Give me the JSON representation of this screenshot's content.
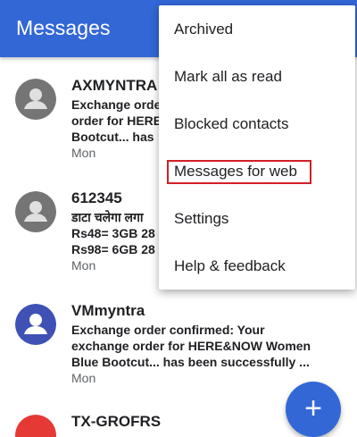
{
  "appbar": {
    "title": "Messages"
  },
  "conversations": [
    {
      "sender": "AXMYNTRA",
      "lines": [
        "Exchange order",
        "order for HERE",
        "Bootcut... has"
      ],
      "date": "Mon",
      "avatar_color": "#757575",
      "avatar_kind": "person-icon"
    },
    {
      "sender": "612345",
      "lines": [
        "डाटा चलेगा लगा",
        "Rs48= 3GB 28",
        "Rs98= 6GB 28"
      ],
      "date": "Mon",
      "avatar_color": "#757575",
      "avatar_kind": "person-icon"
    },
    {
      "sender": "VMmyntra",
      "lines": [
        "Exchange order confirmed: Your",
        "exchange order for HERE&NOW Women",
        "Blue Bootcut... has been successfully ..."
      ],
      "date": "Mon",
      "avatar_color": "#3f51b5",
      "avatar_kind": "person-icon"
    },
    {
      "sender": "TX-GROFRS",
      "lines": [],
      "date": "",
      "avatar_color": "#e53935",
      "avatar_kind": "person-icon"
    }
  ],
  "menu": {
    "items": [
      {
        "label": "Archived"
      },
      {
        "label": "Mark all as read"
      },
      {
        "label": "Blocked contacts"
      },
      {
        "label": "Messages for web"
      },
      {
        "label": "Settings"
      },
      {
        "label": "Help & feedback"
      }
    ],
    "highlight_color": "#d32027"
  },
  "fab": {
    "label": "+",
    "icon": "plus-icon",
    "color": "#3367d6"
  },
  "colors": {
    "primary": "#3367d6"
  }
}
